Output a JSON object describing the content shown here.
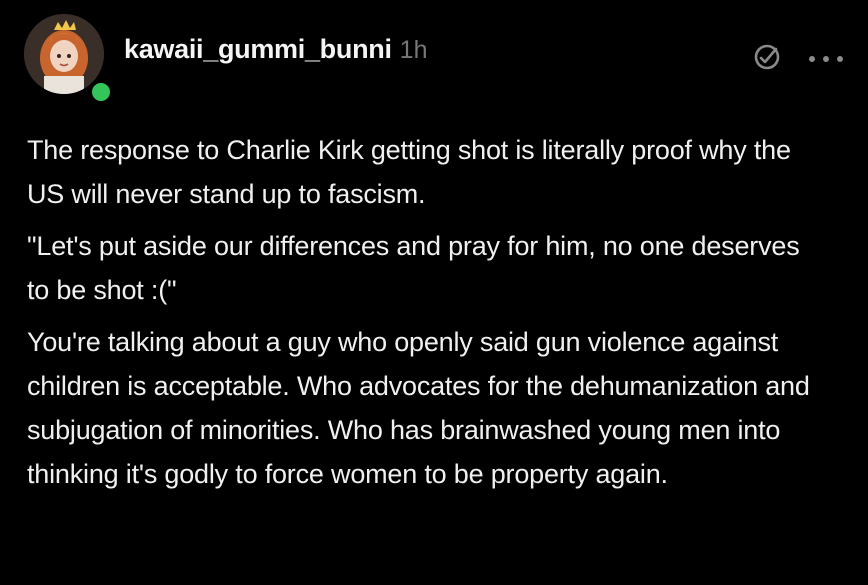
{
  "post": {
    "username": "kawaii_gummi_bunni",
    "time": "1h",
    "status_color": "#33c45a",
    "icons": {
      "moderation": "mod-shield-icon",
      "more": "more-dots-icon"
    },
    "paragraphs": [
      "The response to Charlie Kirk getting shot is literally proof why the US will never stand up to fascism.",
      "\"Let's put aside our differences and pray for him, no one deserves to be shot :(\"",
      "You're talking about a guy who openly said gun violence against children is acceptable. Who advocates for the dehumanization and subjugation of minorities. Who has brainwashed young men into thinking it's godly to force women to be property again."
    ]
  }
}
